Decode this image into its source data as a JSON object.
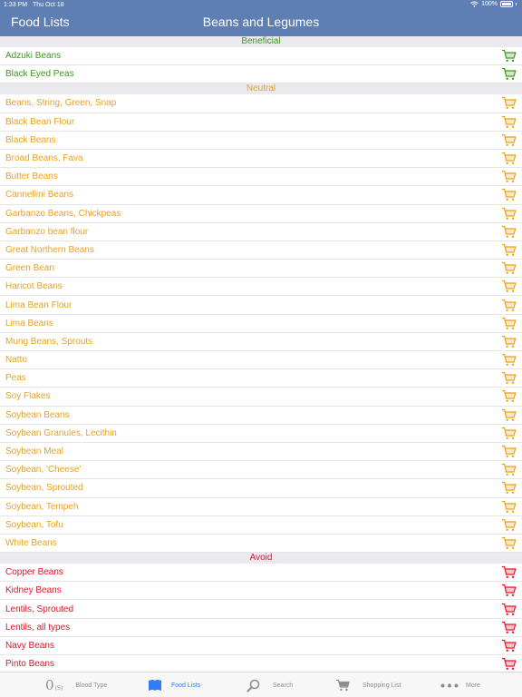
{
  "status": {
    "time": "1:33 PM",
    "date": "Thu Oct 18",
    "battery": "100%"
  },
  "nav": {
    "back_label": "Food Lists",
    "title": "Beans and Legumes"
  },
  "colors": {
    "beneficial": "#3a9a1c",
    "neutral": "#e8a21b",
    "avoid": "#e0142a",
    "nav": "#5f7fb3",
    "tab_active": "#2e7cf6"
  },
  "sections": [
    {
      "header": "Beneficial",
      "kind": "beneficial",
      "items": [
        "Adzuki Beans",
        "Black Eyed Peas"
      ]
    },
    {
      "header": "Neutral",
      "kind": "neutral",
      "items": [
        "Beans, String, Green, Snap",
        "Black Bean Flour",
        "Black Beans",
        "Broad Beans, Fava",
        "Butter Beans",
        "Cannellini Beans",
        "Garbanzo Beans, Chickpeas",
        "Garbanzo bean flour",
        "Great Northern Beans",
        "Green Bean",
        "Haricot Beans",
        "Lima Bean Flour",
        "Lima Beans",
        "Mung Beans, Sprouts",
        "Natto",
        "Peas",
        "Soy Flakes",
        "Soybean Beans",
        "Soybean Granules, Lecithin",
        "Soybean Meal",
        "Soybean, 'Cheese'",
        "Soybean, Sprouted",
        "Soybean, Tempeh",
        "Soybean, Tofu",
        "White Beans"
      ]
    },
    {
      "header": "Avoid",
      "kind": "avoid",
      "items": [
        "Copper Beans",
        "Kidney Beans",
        "Lentils, Sprouted",
        "Lentils, all types",
        "Navy Beans",
        "Pinto Beans"
      ]
    }
  ],
  "tabs": {
    "blood_type": {
      "label": "Blood Type",
      "icon": "blood-type-icon",
      "glyph": "0",
      "glyph_sub": "(S)"
    },
    "food_lists": {
      "label": "Food Lists",
      "icon": "book-icon"
    },
    "search": {
      "label": "Search",
      "icon": "search-icon"
    },
    "shopping_list": {
      "label": "Shopping List",
      "icon": "cart-icon"
    },
    "more": {
      "label": "More",
      "icon": "more-dots-icon"
    }
  }
}
